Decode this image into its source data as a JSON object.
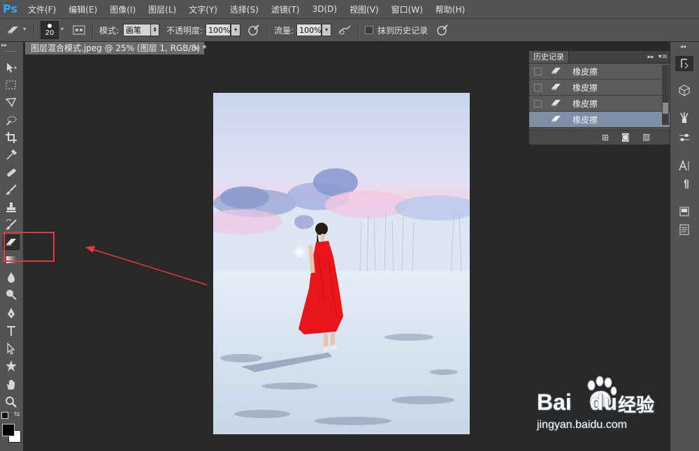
{
  "app": {
    "logo": "Ps"
  },
  "menu": [
    "文件(F)",
    "编辑(E)",
    "图像(I)",
    "图层(L)",
    "文字(Y)",
    "选择(S)",
    "滤镜(T)",
    "3D(D)",
    "视图(V)",
    "窗口(W)",
    "帮助(H)"
  ],
  "options": {
    "brush_size": "20",
    "mode_label": "模式:",
    "mode_value": "画笔",
    "opacity_label": "不透明度:",
    "opacity_value": "100%",
    "flow_label": "流量:",
    "flow_value": "100%",
    "erase_history_label": "抹到历史记录"
  },
  "document": {
    "tab_title": "图层混合模式.jpeg @ 25% (图层 1, RGB/8) *",
    "close": "×"
  },
  "history": {
    "tab": "历史记录",
    "items": [
      {
        "label": "橡皮擦",
        "selected": false
      },
      {
        "label": "橡皮擦",
        "selected": false
      },
      {
        "label": "橡皮擦",
        "selected": false
      },
      {
        "label": "橡皮擦",
        "selected": true
      }
    ]
  },
  "watermark": {
    "brand": "Bai",
    "brand2": "du",
    "cn": "经验",
    "url": "jingyan.baidu.com"
  },
  "colors": {
    "annotation": "#e23b3b",
    "accent": "#31a8ff",
    "selected_row": "#7d8ea6"
  }
}
